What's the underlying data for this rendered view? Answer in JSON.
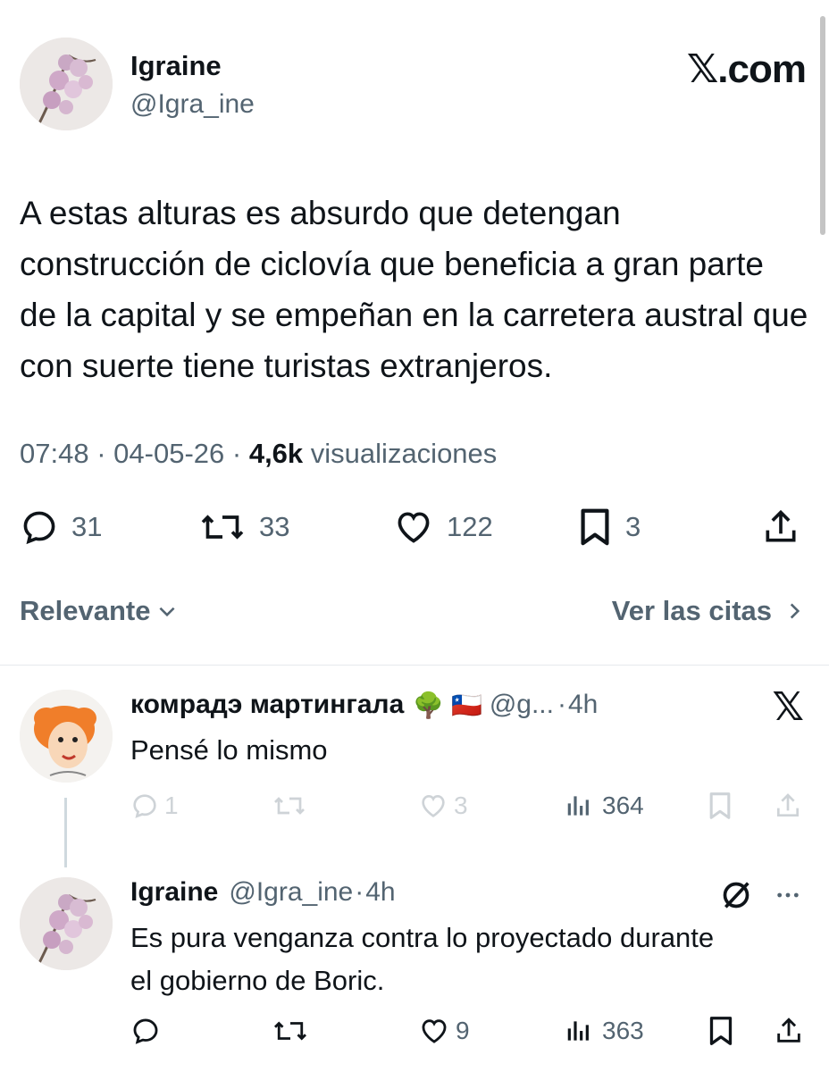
{
  "main_tweet": {
    "author_name": "Igraine",
    "author_handle": "@Igra_ine",
    "brand": "𝕏.com",
    "text": "A estas alturas es absurdo que detengan construcción de ciclovía que beneficia a gran parte de la capital y se empeñan en la carretera austral que con suerte tiene turistas extranjeros.",
    "time": "07:48",
    "date": "04-05-26",
    "views_count": "4,6k",
    "views_label": "visualizaciones",
    "replies": "31",
    "reposts": "33",
    "likes": "122",
    "bookmarks": "3"
  },
  "sort": {
    "label": "Relevante",
    "quotes_link": "Ver las citas"
  },
  "replies": [
    {
      "author_name": "комрадэ мартингала",
      "emoji": "🌳 🇨🇱",
      "handle": "@g...",
      "time": "4h",
      "text": "Pensé lo mismo",
      "replies": "1",
      "reposts": "",
      "likes": "3",
      "views": "364"
    },
    {
      "author_name": "Igraine",
      "handle": "@Igra_ine",
      "time": "4h",
      "text": "Es pura venganza contra lo proyectado durante el gobierno de Boric.",
      "replies": "",
      "reposts": "",
      "likes": "9",
      "views": "363"
    }
  ],
  "separator": "·",
  "colors": {
    "text": "#0f1419",
    "secondary": "#536471",
    "divider": "#e6e9ec"
  }
}
